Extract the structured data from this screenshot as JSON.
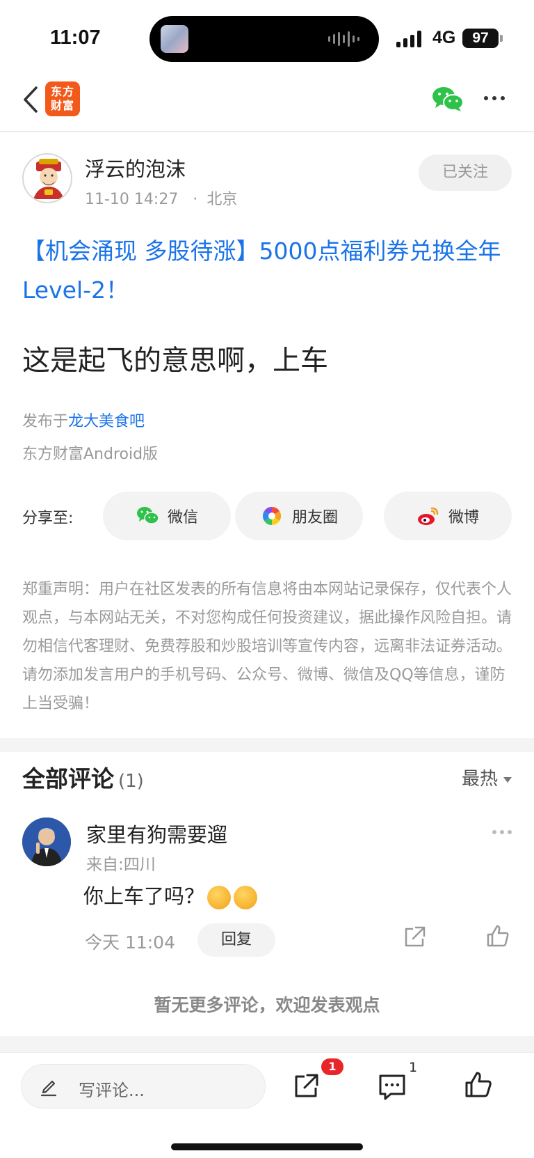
{
  "status_bar": {
    "time": "11:07",
    "network": "4G",
    "battery": "97"
  },
  "nav": {
    "logo_line1": "东方",
    "logo_line2": "财富",
    "back_icon": "chevron-left-icon",
    "share_icon": "wechat-icon",
    "more_icon": "more-icon",
    "brand_color": "#f25a1b"
  },
  "author": {
    "name": "浮云的泡沫",
    "date": "11-10 14:27",
    "separator": "·",
    "location": "北京",
    "follow_label": "已关注"
  },
  "post": {
    "title": "【机会涌现 多股待涨】5000点福利券兑换全年Level-2！",
    "body": "这是起飞的意思啊，上车",
    "source_prefix": "发布于",
    "source_forum": "龙大美食吧",
    "client": "东方财富Android版",
    "link_color": "#1a73e8"
  },
  "share": {
    "label": "分享至:",
    "buttons": [
      {
        "label": "微信",
        "icon": "wechat-icon"
      },
      {
        "label": "朋友圈",
        "icon": "moments-icon"
      },
      {
        "label": "微博",
        "icon": "weibo-icon"
      }
    ]
  },
  "disclaimer": "郑重声明：用户在社区发表的所有信息将由本网站记录保存，仅代表个人观点，与本网站无关，不对您构成任何投资建议，据此操作风险自担。请勿相信代客理财、免费荐股和炒股培训等宣传内容，远离非法证券活动。请勿添加发言用户的手机号码、公众号、微博、微信及QQ等信息，谨防上当受骗！",
  "comments": {
    "title": "全部评论",
    "count": "(1)",
    "sort_label": "最热",
    "items": [
      {
        "name": "家里有狗需要遛",
        "from": "来自:四川",
        "text": "你上车了吗？",
        "emoji_count": 2,
        "time": "今天 11:04",
        "reply_label": "回复"
      }
    ],
    "no_more": "暂无更多评论，欢迎发表观点"
  },
  "bottom_bar": {
    "input_placeholder": "写评论...",
    "share_badge": "1",
    "comment_count": "1",
    "badge_color": "#e8262a"
  }
}
